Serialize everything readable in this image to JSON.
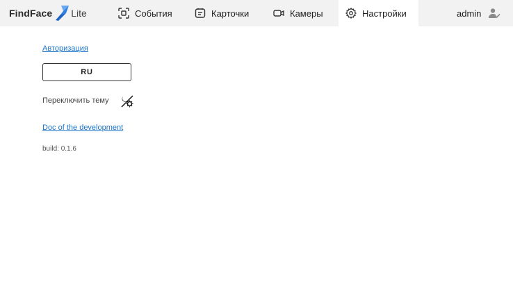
{
  "header": {
    "brand": "FindFace",
    "brand_sub": "Lite",
    "nav": [
      {
        "label": "События",
        "icon": "scan-face-icon"
      },
      {
        "label": "Карточки",
        "icon": "card-icon"
      },
      {
        "label": "Камеры",
        "icon": "camera-icon"
      },
      {
        "label": "Настройки",
        "icon": "gear-icon",
        "active": true
      }
    ],
    "user": "admin",
    "user_icon": "user-check-icon"
  },
  "settings": {
    "auth_link": "Авторизация",
    "language_button": "RU",
    "theme_label": "Переключить тему",
    "theme_icon": "theme-toggle-icon",
    "doc_link": "Doc of the development",
    "build_label": "build:",
    "build_version": "0.1.6"
  },
  "colors": {
    "header_bg": "#f2f2f2",
    "active_tab_bg": "#ffffff",
    "link": "#1a73c7",
    "logo_accent": "#2f7fe0"
  }
}
